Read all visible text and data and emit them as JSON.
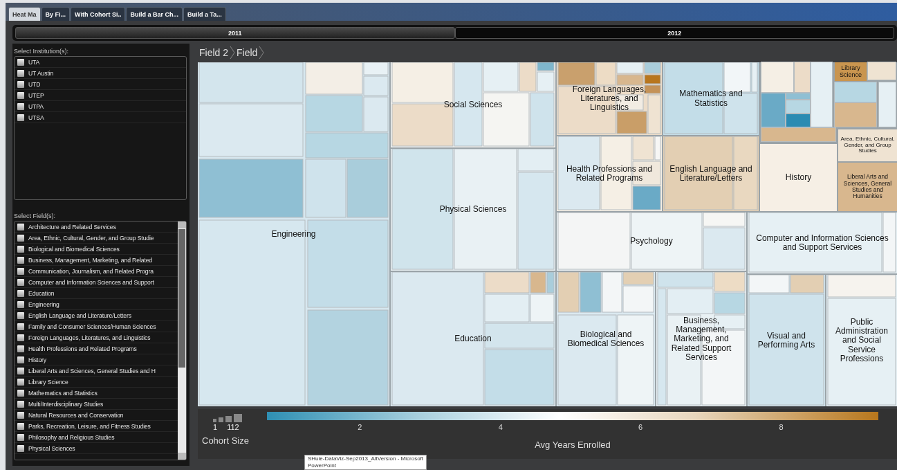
{
  "tabs": [
    {
      "label": "Heat Ma",
      "selected": true
    },
    {
      "label": "By Fi...",
      "selected": false
    },
    {
      "label": "With Cohort Si..",
      "selected": false
    },
    {
      "label": "Build a Bar Ch...",
      "selected": false
    },
    {
      "label": "Build a Ta...",
      "selected": false
    }
  ],
  "years": [
    {
      "label": "2011",
      "selected": true
    },
    {
      "label": "2012",
      "selected": false
    }
  ],
  "institutions": {
    "title": "Select Institution(s):",
    "items": [
      {
        "label": "UTA",
        "checked": false
      },
      {
        "label": "UT Austin",
        "checked": false
      },
      {
        "label": "UTD",
        "checked": false
      },
      {
        "label": "UTEP",
        "checked": false
      },
      {
        "label": "UTPA",
        "checked": false
      },
      {
        "label": "UTSA",
        "checked": false
      }
    ]
  },
  "fields": {
    "title": "Select Field(s):",
    "items": [
      {
        "label": "Architecture and Related Services",
        "checked": false
      },
      {
        "label": "Area, Ethnic, Cultural, Gender, and Group Studie",
        "checked": false
      },
      {
        "label": "Biological and Biomedical Sciences",
        "checked": false
      },
      {
        "label": "Business, Management, Marketing, and Related",
        "checked": false
      },
      {
        "label": "Communication, Journalism, and Related Progra",
        "checked": false
      },
      {
        "label": "Computer and Information Sciences and Support",
        "checked": false
      },
      {
        "label": "Education",
        "checked": false
      },
      {
        "label": "Engineering",
        "checked": false
      },
      {
        "label": "English Language and Literature/Letters",
        "checked": false
      },
      {
        "label": "Family and Consumer Sciences/Human Sciences",
        "checked": false
      },
      {
        "label": "Foreign Languages, Literatures, and Linguistics",
        "checked": false
      },
      {
        "label": "Health Professions and Related Programs",
        "checked": false
      },
      {
        "label": "History",
        "checked": false
      },
      {
        "label": "Liberal Arts and Sciences, General Studies and H",
        "checked": false
      },
      {
        "label": "Library Science",
        "checked": false
      },
      {
        "label": "Mathematics and Statistics",
        "checked": false
      },
      {
        "label": "Multi/Interdisciplinary Studies",
        "checked": false
      },
      {
        "label": "Natural Resources and Conservation",
        "checked": false
      },
      {
        "label": "Parks, Recreation, Leisure, and Fitness Studies",
        "checked": false
      },
      {
        "label": "Philosophy and Religious Studies",
        "checked": false
      },
      {
        "label": "Physical Sciences",
        "checked": false
      }
    ]
  },
  "breadcrumb": [
    "Field 2",
    "Field"
  ],
  "treemap": {
    "groups": [
      {
        "label": "Engineering",
        "color": "#d6e7ef"
      },
      {
        "label": "Social Sciences",
        "color": "#f5f5f2"
      },
      {
        "label": "Physical Sciences",
        "color": "#e9f1f4"
      },
      {
        "label": "Education",
        "color": "#dbe9f0"
      },
      {
        "label": "Foreign Languages, Literatures, and Linguistics",
        "color": "#ecdcc8"
      },
      {
        "label": "Mathematics and Statistics",
        "color": "#c3dde8"
      },
      {
        "label": "Library Science",
        "color": "#c9954f"
      },
      {
        "label": "Health Professions and Related Programs",
        "color": "#f5efe5"
      },
      {
        "label": "English Language and Literature/Letters",
        "color": "#e3cfb3"
      },
      {
        "label": "History",
        "color": "#f6efe5"
      },
      {
        "label": "Area, Ethnic, Cultural, Gender, and Group Studies",
        "color": "#efe3d2"
      },
      {
        "label": "Liberal Arts and Sciences, General Studies and Humanities",
        "color": "#d8b78e"
      },
      {
        "label": "Psychology",
        "color": "#eef4f6"
      },
      {
        "label": "Computer and Information Sciences and Support Services",
        "color": "#e6f0f4"
      },
      {
        "label": "Biological and Biomedical Sciences",
        "color": "#dbe9f0"
      },
      {
        "label": "Business, Management, Marketing, and Related Support Services",
        "color": "#e9f1f4"
      },
      {
        "label": "Visual and Performing Arts",
        "color": "#cfe3ec"
      },
      {
        "label": "Public Administration and Social Service Professions",
        "color": "#e6f0f4"
      }
    ]
  },
  "legend": {
    "size_min": "1",
    "size_max": "112",
    "size_title": "Cohort Size",
    "ticks": [
      "2",
      "4",
      "6",
      "8"
    ],
    "color_title": "Avg Years Enrolled"
  },
  "tooltip": {
    "lines": [
      "SHuie-DataViz-Sep2013_AltVersion - Microsoft",
      "PowerPoint"
    ]
  }
}
